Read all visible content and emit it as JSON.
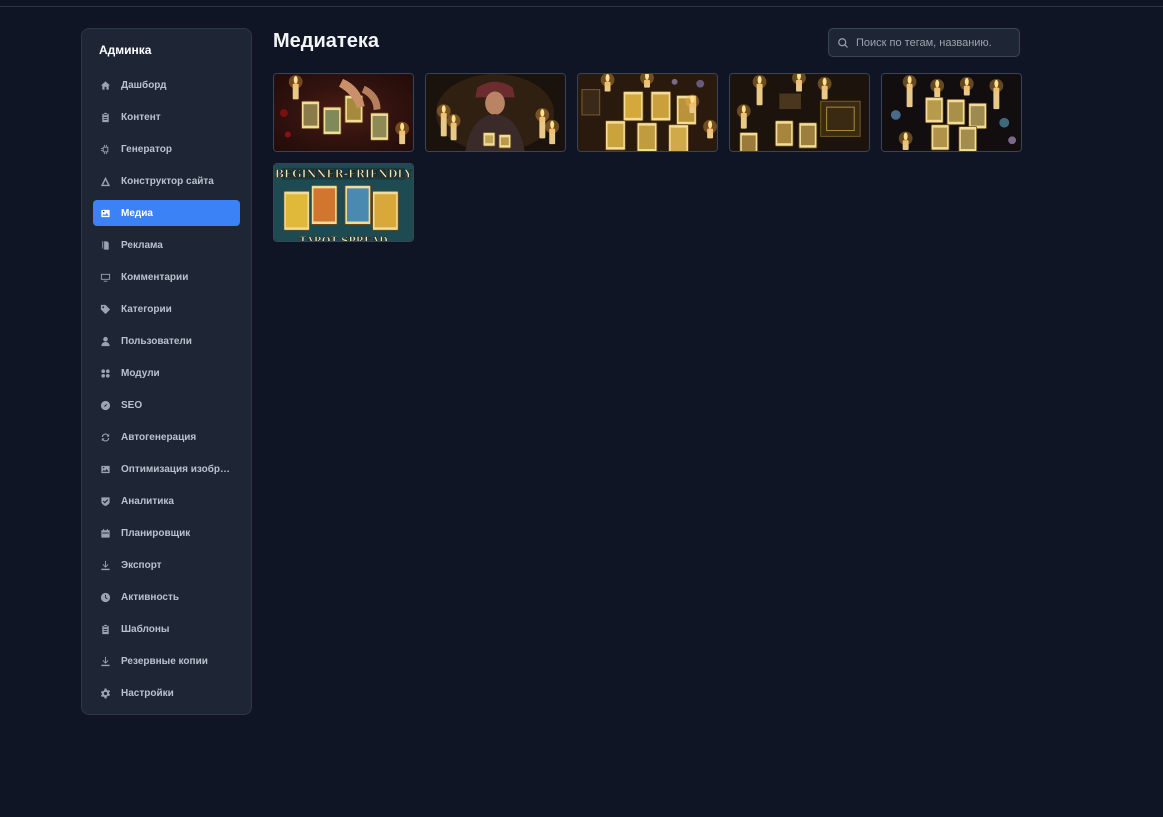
{
  "sidebar": {
    "title": "Админка",
    "items": [
      {
        "label": "Дашборд",
        "icon": "home-icon",
        "active": false
      },
      {
        "label": "Контент",
        "icon": "clipboard-icon",
        "active": false
      },
      {
        "label": "Генератор",
        "icon": "chip-icon",
        "active": false
      },
      {
        "label": "Конструктор сайта",
        "icon": "triangle-icon",
        "active": false
      },
      {
        "label": "Медиа",
        "icon": "image-icon",
        "active": true
      },
      {
        "label": "Реклама",
        "icon": "book-icon",
        "active": false
      },
      {
        "label": "Комментарии",
        "icon": "monitor-icon",
        "active": false
      },
      {
        "label": "Категории",
        "icon": "tag-icon",
        "active": false
      },
      {
        "label": "Пользователи",
        "icon": "user-icon",
        "active": false
      },
      {
        "label": "Модули",
        "icon": "grid-icon",
        "active": false
      },
      {
        "label": "SEO",
        "icon": "compass-icon",
        "active": false
      },
      {
        "label": "Автогенерация",
        "icon": "refresh-icon",
        "active": false
      },
      {
        "label": "Оптимизация изобра...",
        "icon": "image-icon",
        "active": false
      },
      {
        "label": "Аналитика",
        "icon": "shield-check-icon",
        "active": false
      },
      {
        "label": "Планировщик",
        "icon": "calendar-icon",
        "active": false
      },
      {
        "label": "Экспорт",
        "icon": "download-icon",
        "active": false
      },
      {
        "label": "Активность",
        "icon": "clock-icon",
        "active": false
      },
      {
        "label": "Шаблоны",
        "icon": "clipboard-icon",
        "active": false
      },
      {
        "label": "Резервные копии",
        "icon": "download-icon",
        "active": false
      },
      {
        "label": "Настройки",
        "icon": "gear-icon",
        "active": false
      }
    ]
  },
  "main": {
    "title": "Медиатека",
    "search": {
      "placeholder": "Поиск по тегам, названию.",
      "value": ""
    },
    "media": [
      {
        "subject": "tarot cards with red candles"
      },
      {
        "subject": "fortune teller reading cards"
      },
      {
        "subject": "tarot spread with candles"
      },
      {
        "subject": "candles and tarot deck"
      },
      {
        "subject": "tarot layout with crystals"
      },
      {
        "subject": "tarot spread poster",
        "text_top": "BEGINNER-FRIENDLY",
        "text_bottom": "TAROT SPREAD"
      }
    ]
  },
  "colors": {
    "background": "#0f1524",
    "sidebar": "#1e2636",
    "accent": "#3b82f6"
  }
}
